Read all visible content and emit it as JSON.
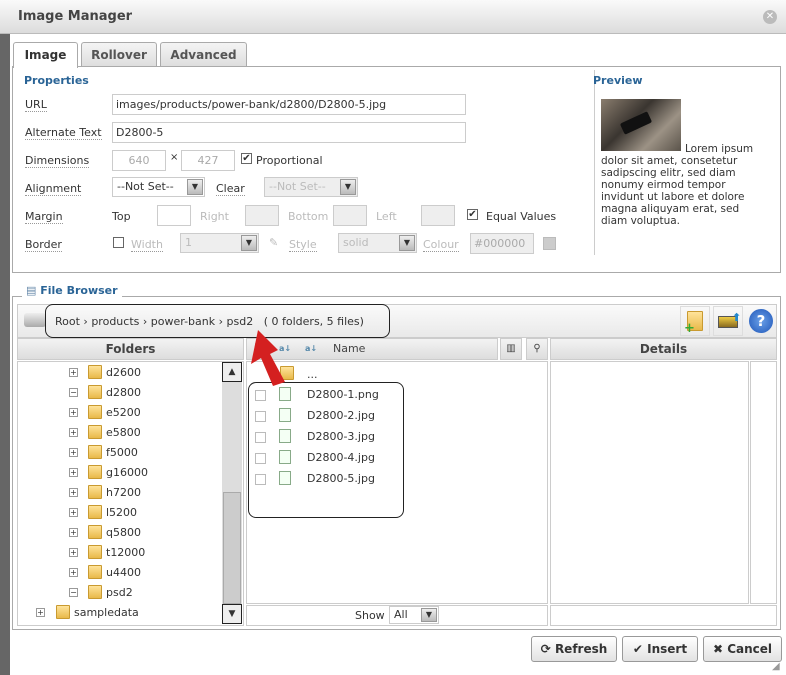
{
  "window": {
    "title": "Image Manager"
  },
  "tabs": [
    {
      "label": "Image",
      "active": true
    },
    {
      "label": "Rollover"
    },
    {
      "label": "Advanced"
    }
  ],
  "properties": {
    "heading": "Properties",
    "url_label": "URL",
    "url": "images/products/power-bank/d2800/D2800-5.jpg",
    "alt_label": "Alternate Text",
    "alt": "D2800-5",
    "dimensions_label": "Dimensions",
    "width": "640",
    "times": "×",
    "height": "427",
    "proportional_label": "Proportional",
    "proportional": true,
    "alignment_label": "Alignment",
    "alignment": "--Not Set--",
    "clear_label": "Clear",
    "clear": "--Not Set--",
    "margin_label": "Margin",
    "top_label": "Top",
    "right_label": "Right",
    "bottom_label": "Bottom",
    "left_label": "Left",
    "equal_label": "Equal Values",
    "equal": true,
    "border_label": "Border",
    "border_width_label": "Width",
    "border_width": "1",
    "style_label": "Style",
    "style": "solid",
    "colour_label": "Colour",
    "colour": "#000000"
  },
  "preview": {
    "heading": "Preview",
    "text": "Lorem ipsum dolor sit amet, consetetur sadipscing elitr, sed diam nonumy eirmod tempor invidunt ut labore et dolore magna aliquyam erat, sed diam voluptua."
  },
  "file_browser": {
    "legend": "File Browser",
    "breadcrumb": [
      "Root",
      "products",
      "power-bank",
      "psd2"
    ],
    "summary": "( 0 folders, 5 files)",
    "folders_header": "Folders",
    "name_header": "Name",
    "details_header": "Details",
    "folders": [
      {
        "name": "d2600",
        "toggle": "+"
      },
      {
        "name": "d2800",
        "toggle": "−"
      },
      {
        "name": "e5200",
        "toggle": "+"
      },
      {
        "name": "e5800",
        "toggle": "+"
      },
      {
        "name": "f5000",
        "toggle": "+"
      },
      {
        "name": "g16000",
        "toggle": "+"
      },
      {
        "name": "h7200",
        "toggle": "+"
      },
      {
        "name": "l5200",
        "toggle": "+"
      },
      {
        "name": "q5800",
        "toggle": "+"
      },
      {
        "name": "t12000",
        "toggle": "+"
      },
      {
        "name": "u4400",
        "toggle": "+"
      },
      {
        "name": "psd2",
        "toggle": "−"
      }
    ],
    "root_folder": {
      "name": "sampledata",
      "toggle": "+"
    },
    "parent": "...",
    "files": [
      "D2800-1.png",
      "D2800-2.jpg",
      "D2800-3.jpg",
      "D2800-4.jpg",
      "D2800-5.jpg"
    ],
    "show_label": "Show",
    "show_value": "All"
  },
  "buttons": {
    "refresh": "Refresh",
    "insert": "Insert",
    "cancel": "Cancel"
  },
  "colors": {
    "heading": "#2a6496",
    "arrow": "#d42020"
  }
}
